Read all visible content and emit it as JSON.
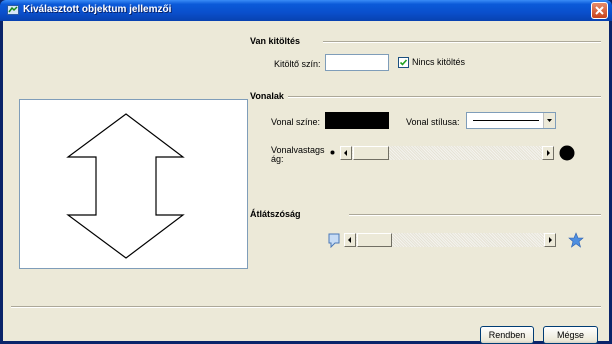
{
  "window": {
    "title": "Kiválasztott objektum jellemzői"
  },
  "fill": {
    "section_title": "Van kitöltés",
    "color_label": "Kitöltő szín:",
    "no_fill_label": "Nincs kitöltés",
    "no_fill_checked": true
  },
  "lines": {
    "section_title": "Vonalak",
    "color_label": "Vonal színe:",
    "color_value": "#000000",
    "style_label": "Vonal stílusa:",
    "width_label_line1": "Vonalvastags",
    "width_label_line2": "ág:"
  },
  "transparency": {
    "section_title": "Átlátszóság"
  },
  "buttons": {
    "ok": "Rendben",
    "cancel": "Mégse"
  },
  "icons": {
    "title": "dialog-icon",
    "close": "close-icon",
    "small_dot": "thin-line-dot-icon",
    "big_dot": "thick-line-dot-icon",
    "transparent_low": "transparency-low-icon",
    "transparent_high": "star-icon"
  }
}
